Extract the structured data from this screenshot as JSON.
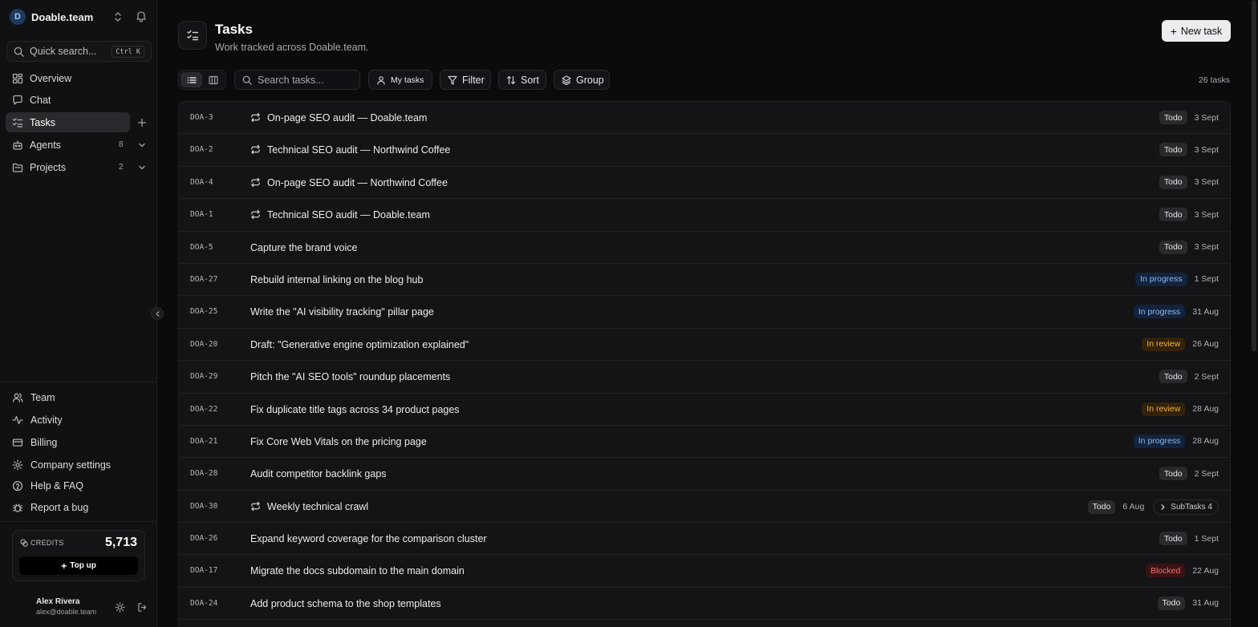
{
  "workspace": {
    "initial": "D",
    "name": "Doable.team"
  },
  "quick_search": {
    "label": "Quick search...",
    "shortcut": "Ctrl K"
  },
  "nav": {
    "overview": "Overview",
    "chat": "Chat",
    "tasks": "Tasks",
    "agents": {
      "label": "Agents",
      "count": "8"
    },
    "projects": {
      "label": "Projects",
      "count": "2"
    }
  },
  "bottom_nav": {
    "team": "Team",
    "activity": "Activity",
    "billing": "Billing",
    "company_settings": "Company settings",
    "help": "Help & FAQ",
    "report_bug": "Report a bug"
  },
  "credits": {
    "label": "CREDITS",
    "amount": "5,713",
    "topup": "Top up"
  },
  "user": {
    "name": "Alex Rivera",
    "email": "alex@doable.team"
  },
  "header": {
    "title": "Tasks",
    "subtitle": "Work tracked across Doable.team.",
    "new_task": "New task"
  },
  "toolbar": {
    "search_placeholder": "Search tasks...",
    "my_tasks": "My tasks",
    "filter": "Filter",
    "sort": "Sort",
    "group": "Group",
    "count": "26 tasks"
  },
  "tasks": [
    {
      "id": "DOA-3",
      "title": "On-page SEO audit — Doable.team",
      "status": "Todo",
      "date": "3 Sept"
    },
    {
      "id": "DOA-2",
      "title": "Technical SEO audit — Northwind Coffee",
      "status": "Todo",
      "date": "3 Sept"
    },
    {
      "id": "DOA-4",
      "title": "On-page SEO audit — Northwind Coffee",
      "status": "Todo",
      "date": "3 Sept"
    },
    {
      "id": "DOA-1",
      "title": "Technical SEO audit — Doable.team",
      "status": "Todo",
      "date": "3 Sept"
    },
    {
      "id": "DOA-5",
      "title": "Capture the brand voice",
      "status": "Todo",
      "date": "3 Sept"
    },
    {
      "id": "DOA-27",
      "title": "Rebuild internal linking on the blog hub",
      "status": "In progress",
      "date": "1 Sept"
    },
    {
      "id": "DOA-25",
      "title": "Write the \"AI visibility tracking\" pillar page",
      "status": "In progress",
      "date": "31 Aug"
    },
    {
      "id": "DOA-20",
      "title": "Draft: \"Generative engine optimization explained\"",
      "status": "In review",
      "date": "26 Aug"
    },
    {
      "id": "DOA-29",
      "title": "Pitch the \"AI SEO tools\" roundup placements",
      "status": "Todo",
      "date": "2 Sept"
    },
    {
      "id": "DOA-22",
      "title": "Fix duplicate title tags across 34 product pages",
      "status": "In review",
      "date": "28 Aug"
    },
    {
      "id": "DOA-21",
      "title": "Fix Core Web Vitals on the pricing page",
      "status": "In progress",
      "date": "28 Aug"
    },
    {
      "id": "DOA-28",
      "title": "Audit competitor backlink gaps",
      "status": "Todo",
      "date": "2 Sept"
    },
    {
      "id": "DOA-30",
      "title": "Weekly technical crawl",
      "status": "Todo",
      "date": "6 Aug",
      "subtasks": "SubTasks 4"
    },
    {
      "id": "DOA-26",
      "title": "Expand keyword coverage for the comparison cluster",
      "status": "Todo",
      "date": "1 Sept"
    },
    {
      "id": "DOA-17",
      "title": "Migrate the docs subdomain to the main domain",
      "status": "Blocked",
      "date": "22 Aug"
    },
    {
      "id": "DOA-24",
      "title": "Add product schema to the shop templates",
      "status": "Todo",
      "date": "31 Aug"
    }
  ]
}
